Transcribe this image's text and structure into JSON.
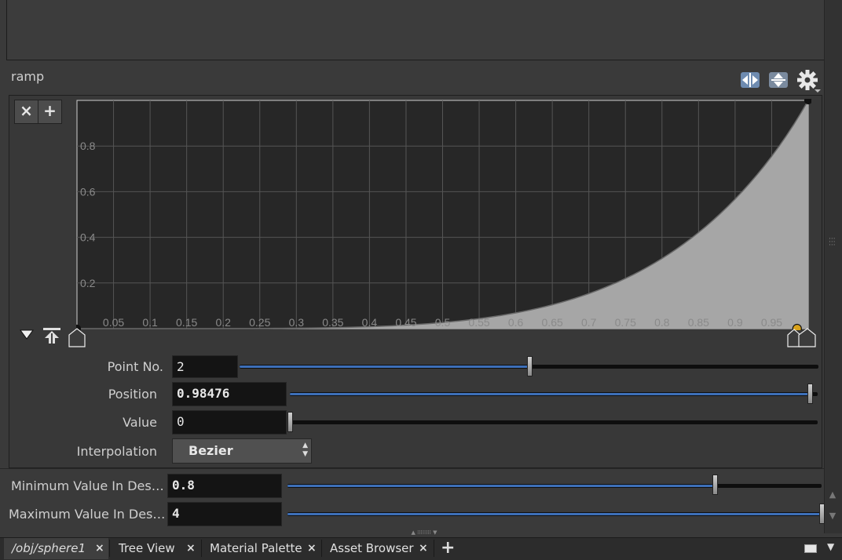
{
  "ramp": {
    "label": "ramp",
    "delete_label": "×",
    "add_label": "+",
    "y_ticks": [
      "0.2",
      "0.4",
      "0.6",
      "0.8"
    ],
    "x_ticks": [
      "0.05",
      "0.1",
      "0.15",
      "0.2",
      "0.25",
      "0.3",
      "0.35",
      "0.4",
      "0.45",
      "0.5",
      "0.55",
      "0.6",
      "0.65",
      "0.7",
      "0.75",
      "0.8",
      "0.85",
      "0.9",
      "0.95"
    ],
    "points": [
      {
        "position": 0.0,
        "value": 0.0
      },
      {
        "position": 0.98476,
        "value": 0.0
      },
      {
        "position": 1.0,
        "value": 1.0
      }
    ],
    "selected_point": 2
  },
  "params": {
    "point_no_label": "Point No.",
    "point_no_value": "2",
    "point_no_slider": 0.5,
    "position_label": "Position",
    "position_value": "0.98476",
    "position_slider": 0.98476,
    "value_label": "Value",
    "value_value": "0",
    "value_slider": 0.0,
    "interp_label": "Interpolation",
    "interp_value": "Bezier",
    "min_label": "Minimum Value In Des…",
    "min_value": "0.8",
    "min_slider": 0.8,
    "max_label": "Maximum Value In Des…",
    "max_value": "4",
    "max_slider": 1.0
  },
  "tabs": [
    {
      "label": "/obj/sphere1"
    },
    {
      "label": "Tree View"
    },
    {
      "label": "Material Palette"
    },
    {
      "label": "Asset Browser"
    }
  ],
  "tab_close_glyph": "×",
  "tab_add_glyph": "+",
  "colors": {
    "slider_fill": "#3d6fb8",
    "selected_point": "#d9a21b"
  }
}
